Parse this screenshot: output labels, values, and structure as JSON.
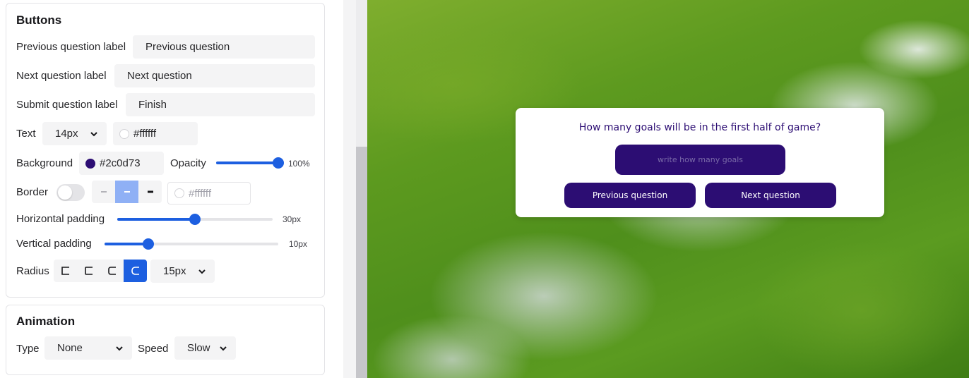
{
  "buttons_section": {
    "title": "Buttons",
    "prev_label": {
      "label": "Previous question label",
      "value": "Previous question"
    },
    "next_label": {
      "label": "Next question label",
      "value": "Next question"
    },
    "submit_label": {
      "label": "Submit question label",
      "value": "Finish"
    },
    "text": {
      "label": "Text",
      "size": "14px",
      "color": "#ffffff"
    },
    "background": {
      "label": "Background",
      "color": "#2c0d73",
      "opacity_label": "Opacity",
      "opacity_value": "100%",
      "opacity_fraction": 1.0
    },
    "border": {
      "label": "Border",
      "enabled": false,
      "color": "#ffffff",
      "selected_style": "medium"
    },
    "horizontal_padding": {
      "label": "Horizontal padding",
      "value": "30px",
      "fraction": 0.5
    },
    "vertical_padding": {
      "label": "Vertical padding",
      "value": "10px",
      "fraction": 0.25
    },
    "radius": {
      "label": "Radius",
      "value": "15px",
      "selected_index": 3
    }
  },
  "animation_section": {
    "title": "Animation",
    "type": {
      "label": "Type",
      "value": "None"
    },
    "speed": {
      "label": "Speed",
      "value": "Slow"
    }
  },
  "preview": {
    "question": "How many goals will be in the first half of game?",
    "input_placeholder": "write how many goals",
    "prev_button": "Previous question",
    "next_button": "Next question"
  },
  "colors": {
    "accent": "#1d5fe0",
    "button_bg": "#2c0d73",
    "button_text": "#ffffff"
  }
}
